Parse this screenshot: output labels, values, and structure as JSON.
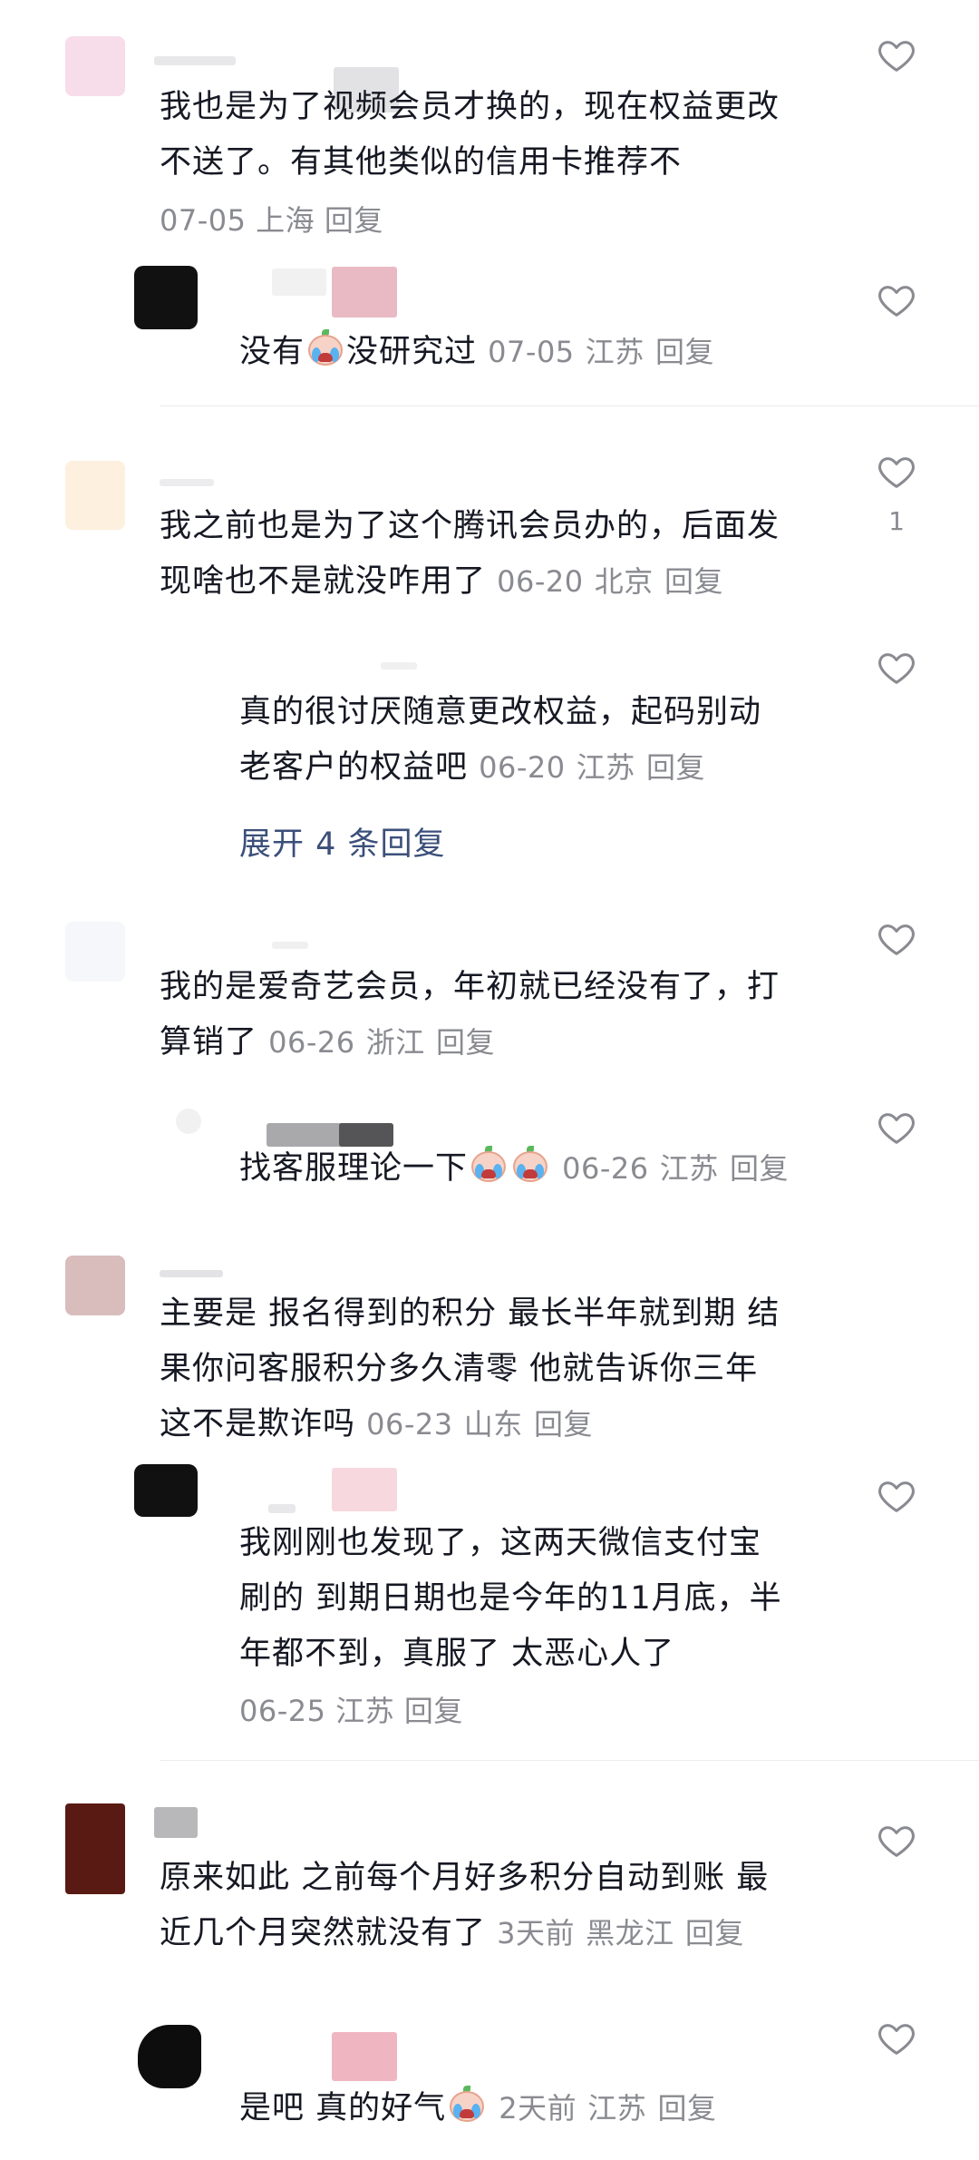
{
  "comments": [
    {
      "text_lines": [
        "我也是为了视频会员才换的，现在权益更改",
        "不送了。有其他类似的信用卡推荐不"
      ],
      "date": "07-05",
      "location": "上海",
      "reply": "回复",
      "reply_item": {
        "text_before": "没有",
        "emoji": "crying-face",
        "text_after": "没研究过",
        "date": "07-05",
        "location": "江苏",
        "reply": "回复"
      }
    },
    {
      "text_lines": [
        "我之前也是为了这个腾讯会员办的，后面发",
        "现啥也不是就没咋用了"
      ],
      "date": "06-20",
      "location": "北京",
      "reply": "回复",
      "like_count": "1",
      "reply_item": {
        "text_lines": [
          "真的很讨厌随意更改权益，起码别动",
          "老客户的权益吧"
        ],
        "date": "06-20",
        "location": "江苏",
        "reply": "回复"
      },
      "expand_label": "展开 4 条回复"
    },
    {
      "text_lines": [
        "我的是爱奇艺会员，年初就已经没有了，打",
        "算销了"
      ],
      "date": "06-26",
      "location": "浙江",
      "reply": "回复",
      "reply_item": {
        "text_before": "找客服理论一下",
        "emoji": "crying-face",
        "date": "06-26",
        "location": "江苏",
        "reply": "回复"
      }
    },
    {
      "text_lines": [
        "主要是 报名得到的积分 最长半年就到期 结",
        "果你问客服积分多久清零 他就告诉你三年",
        "这不是欺诈吗"
      ],
      "date": "06-23",
      "location": "山东",
      "reply": "回复",
      "reply_item": {
        "text_lines": [
          "我刚刚也发现了，这两天微信支付宝",
          "刷的 到期日期也是今年的11月底，半",
          "年都不到，真服了 太恶心人了"
        ],
        "date": "06-25",
        "location": "江苏",
        "reply": "回复"
      }
    },
    {
      "text_lines": [
        "原来如此 之前每个月好多积分自动到账 最",
        "近几个月突然就没有了"
      ],
      "date": "3天前",
      "location": "黑龙江",
      "reply": "回复",
      "reply_item": {
        "text_before": "是吧 真的好气",
        "emoji": "crying-face",
        "date": "2天前",
        "location": "江苏",
        "reply": "回复"
      }
    }
  ],
  "icons": {
    "like": "heart-outline-icon",
    "emoji": "crying-face-emoji-icon"
  },
  "colors": {
    "text": "#161823",
    "meta": "#8a8b91",
    "expand": "#3b4f7a"
  }
}
